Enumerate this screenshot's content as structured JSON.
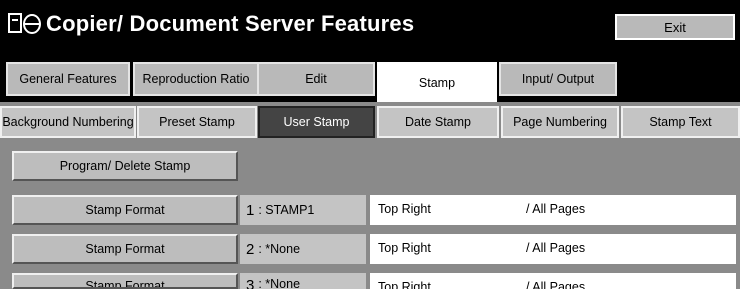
{
  "window": {
    "title": "Copier/ Document Server Features",
    "exit_label": "Exit"
  },
  "tabs": [
    {
      "label": "General Features",
      "active": false
    },
    {
      "label": "Reproduction Ratio",
      "active": false
    },
    {
      "label": "Edit",
      "active": false
    },
    {
      "label": "Stamp",
      "active": true
    },
    {
      "label": "Input/ Output",
      "active": false
    }
  ],
  "subtabs": [
    {
      "label": "Background Numbering",
      "selected": false
    },
    {
      "label": "Preset Stamp",
      "selected": false
    },
    {
      "label": "User Stamp",
      "selected": true
    },
    {
      "label": "Date Stamp",
      "selected": false
    },
    {
      "label": "Page Numbering",
      "selected": false
    },
    {
      "label": "Stamp Text",
      "selected": false
    }
  ],
  "panel": {
    "program_button_label": "Program/ Delete Stamp",
    "rows": [
      {
        "button_label": "Stamp Format",
        "index": "1",
        "name": ": STAMP1",
        "position": "Top Right",
        "pages": "/ All Pages"
      },
      {
        "button_label": "Stamp Format",
        "index": "2",
        "name": ": *None",
        "position": "Top Right",
        "pages": "/ All Pages"
      },
      {
        "button_label": "Stamp Format",
        "index": "3",
        "name": ": *None",
        "position": "Top Right",
        "pages": "/ All Pages"
      }
    ]
  },
  "icons": {
    "title_icon": "copier-document-server-icon"
  },
  "colors": {
    "background": "#000000",
    "button_gray": "#bdbdbd",
    "panel_gray": "#8a8a8a",
    "selected_dark": "#444444"
  }
}
